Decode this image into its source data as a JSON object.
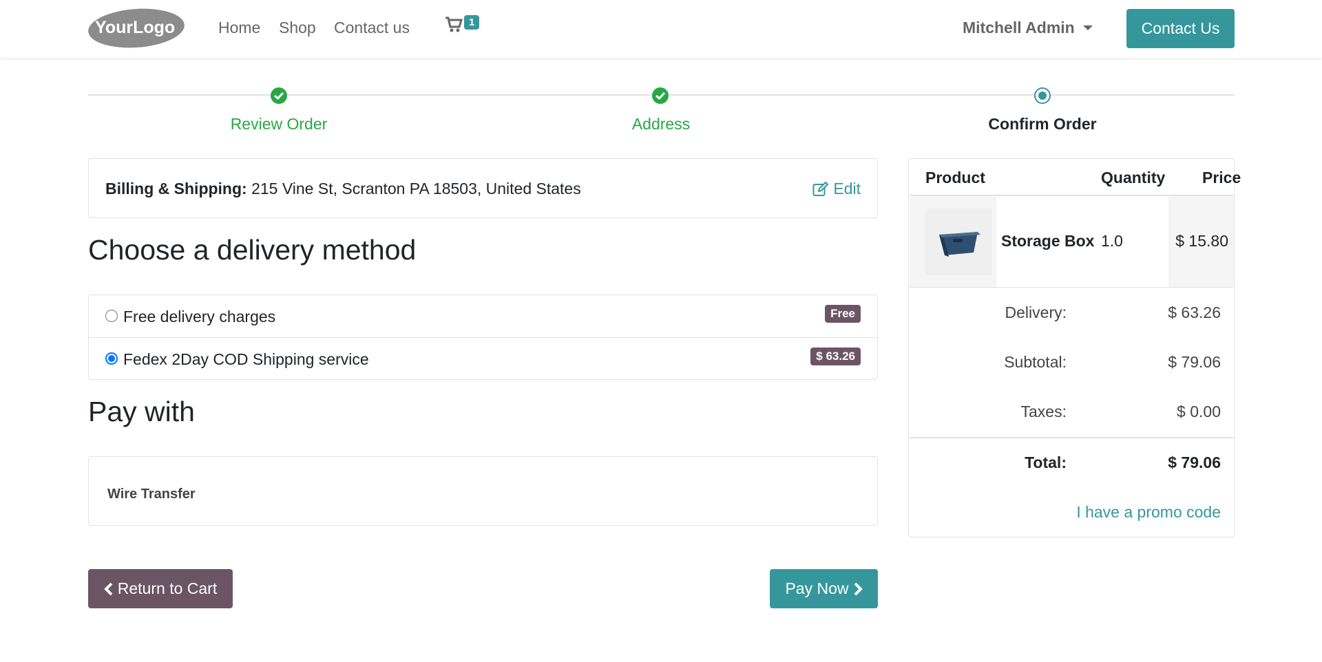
{
  "header": {
    "logo_text": "YourLogo",
    "nav": [
      {
        "label": "Home"
      },
      {
        "label": "Shop"
      },
      {
        "label": "Contact us"
      }
    ],
    "cart_count": "1",
    "user_name": "Mitchell Admin",
    "contact_button": "Contact Us"
  },
  "progress": {
    "steps": [
      {
        "label": "Review Order",
        "state": "done"
      },
      {
        "label": "Address",
        "state": "done"
      },
      {
        "label": "Confirm Order",
        "state": "active"
      }
    ]
  },
  "billing": {
    "label": "Billing & Shipping:",
    "address": "215 Vine St, Scranton PA 18503, United States",
    "edit_label": "Edit"
  },
  "delivery": {
    "heading": "Choose a delivery method",
    "options": [
      {
        "label": "Free delivery charges",
        "badge": "Free",
        "selected": false
      },
      {
        "label": "Fedex 2Day COD Shipping service",
        "badge": "$ 63.26",
        "selected": true
      }
    ]
  },
  "payment": {
    "heading": "Pay with",
    "method": "Wire Transfer"
  },
  "actions": {
    "return_label": "Return to Cart",
    "pay_label": "Pay Now"
  },
  "summary": {
    "columns": {
      "product": "Product",
      "quantity": "Quantity",
      "price": "Price"
    },
    "item": {
      "name": "Storage Box",
      "quantity": "1.0",
      "price": "$ 15.80"
    },
    "delivery_label": "Delivery:",
    "delivery_value": "$ 63.26",
    "subtotal_label": "Subtotal:",
    "subtotal_value": "$ 79.06",
    "taxes_label": "Taxes:",
    "taxes_value": "$ 0.00",
    "total_label": "Total:",
    "total_value": "$ 79.06",
    "promo_label": "I have a promo code"
  },
  "colors": {
    "primary": "#35979c",
    "secondary": "#6b5565",
    "success": "#28a745"
  }
}
